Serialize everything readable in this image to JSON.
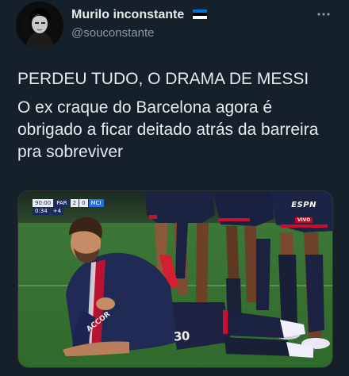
{
  "author": {
    "name": "Murilo inconstante",
    "handle": "@souconstante",
    "badge_icon": "estonia-flag-icon",
    "badge_colors": [
      "#0072ce",
      "#000000",
      "#ffffff"
    ]
  },
  "more_menu": {
    "icon": "more-horizontal-icon"
  },
  "tweet": {
    "headline": "PERDEU TUDO, O DRAMA DE MESSI",
    "body": "O ex craque do Barcelona agora é obrigado a ficar deitado atrás da barreira pra sobreviver"
  },
  "media": {
    "scorebug": {
      "time": "90:00",
      "home": "PAR",
      "home_score": "2",
      "away_score": "0",
      "away": "MCI",
      "period_time": "0:34",
      "added_time": "+4"
    },
    "broadcaster": {
      "logo": "ESPN",
      "live_label": "VIVO"
    },
    "player_number": "30",
    "sponsor": "ACCOR"
  },
  "colors": {
    "background": "#15202b",
    "text": "#e7e9ea",
    "secondary_text": "#8b98a5"
  }
}
